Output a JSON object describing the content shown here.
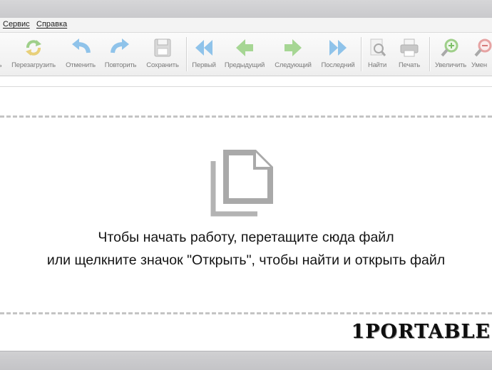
{
  "menu": {
    "items": [
      "Сервис",
      "Справка"
    ]
  },
  "toolbar": {
    "buttons": [
      {
        "label": "ь",
        "icon": "partial-icon"
      },
      {
        "label": "Перезагрузить",
        "icon": "reload-icon"
      },
      {
        "label": "Отменить",
        "icon": "undo-icon"
      },
      {
        "label": "Повторить",
        "icon": "redo-icon"
      },
      {
        "label": "Сохранить",
        "icon": "save-icon"
      },
      {
        "label": "Первый",
        "icon": "first-page-icon"
      },
      {
        "label": "Предыдущий",
        "icon": "previous-page-icon"
      },
      {
        "label": "Следующий",
        "icon": "next-page-icon"
      },
      {
        "label": "Последний",
        "icon": "last-page-icon"
      },
      {
        "label": "Найти",
        "icon": "find-icon"
      },
      {
        "label": "Печать",
        "icon": "print-icon"
      },
      {
        "label": "Увеличить",
        "icon": "zoom-in-icon"
      },
      {
        "label": "Умен",
        "icon": "zoom-out-icon"
      }
    ]
  },
  "content": {
    "line1": "Чтобы начать работу, перетащите сюда файл",
    "line2": "или щелкните значок \"Открыть\", чтобы найти и открыть файл"
  },
  "watermark": "1PORTABLE",
  "colors": {
    "toolbar_icon_blue": "#8fc3ea",
    "toolbar_icon_green": "#9fd48c",
    "doc_icon_gray": "#a9a9a9"
  }
}
